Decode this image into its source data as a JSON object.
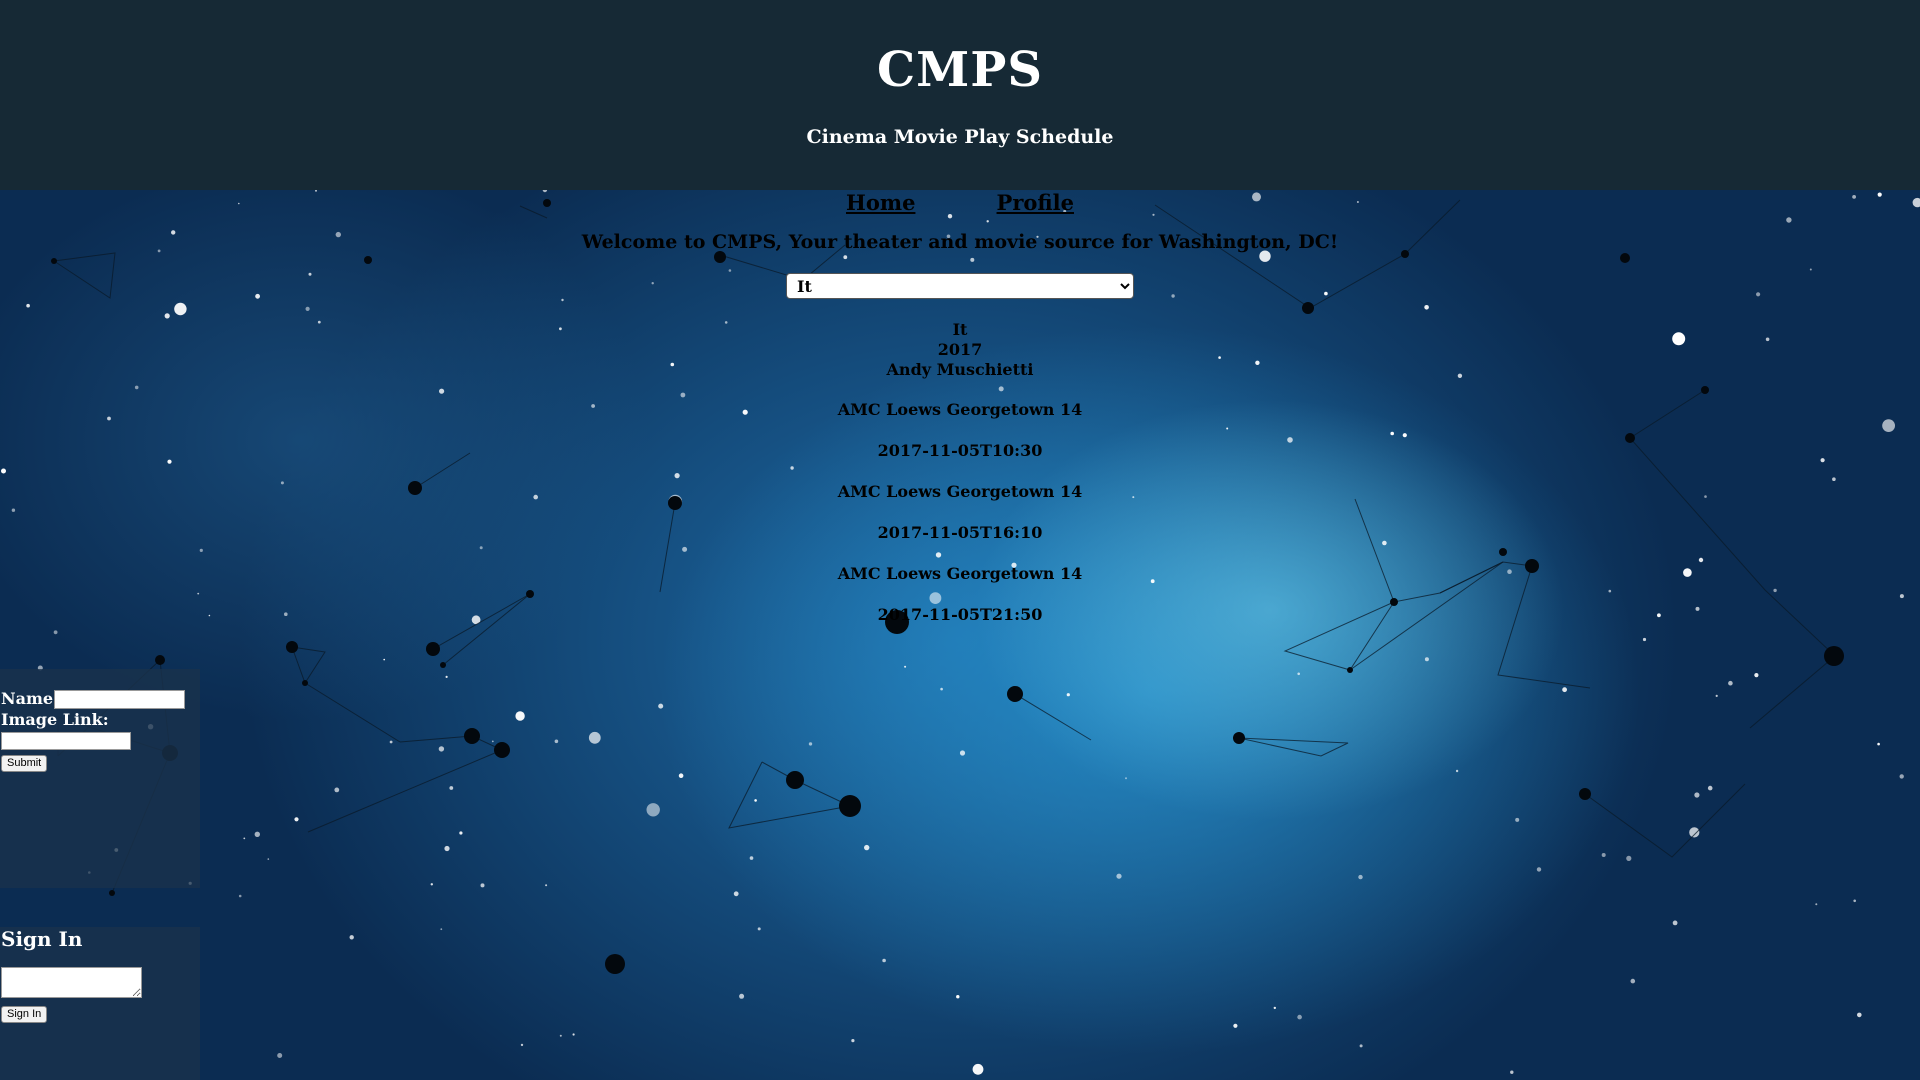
{
  "header": {
    "title": "CMPS",
    "subtitle": "Cinema Movie Play Schedule"
  },
  "nav": {
    "home_label": "Home",
    "profile_label": "Profile"
  },
  "welcome_text": "Welcome to CMPS, Your theater and movie source for Washington, DC!",
  "movie_select": {
    "selected": "It"
  },
  "movie": {
    "title": "It",
    "year": "2017",
    "director": "Andy Muschietti"
  },
  "showtimes": [
    {
      "theater": "AMC Loews Georgetown 14",
      "time": "2017-11-05T10:30"
    },
    {
      "theater": "AMC Loews Georgetown 14",
      "time": "2017-11-05T16:10"
    },
    {
      "theater": "AMC Loews Georgetown 14",
      "time": "2017-11-05T21:50"
    }
  ],
  "post_form": {
    "name_label": "Name:",
    "image_link_label": "Image Link:",
    "submit_label": "Submit"
  },
  "signin": {
    "heading": "Sign In",
    "button_label": "Sign In"
  },
  "colors": {
    "header_bg": "#162935",
    "panel_bg": "#19324b",
    "text_dark": "#000000",
    "text_light": "#ffffff"
  }
}
